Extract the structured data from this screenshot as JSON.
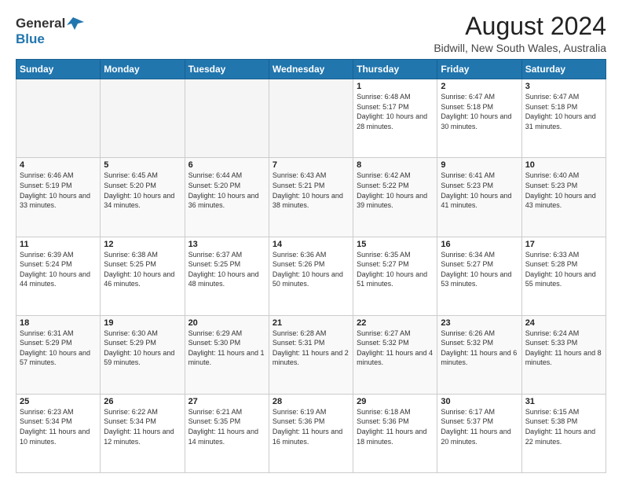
{
  "logo": {
    "line1": "General",
    "line2": "Blue"
  },
  "title": "August 2024",
  "subtitle": "Bidwill, New South Wales, Australia",
  "days_of_week": [
    "Sunday",
    "Monday",
    "Tuesday",
    "Wednesday",
    "Thursday",
    "Friday",
    "Saturday"
  ],
  "weeks": [
    [
      {
        "day": "",
        "info": ""
      },
      {
        "day": "",
        "info": ""
      },
      {
        "day": "",
        "info": ""
      },
      {
        "day": "",
        "info": ""
      },
      {
        "day": "1",
        "info": "Sunrise: 6:48 AM\nSunset: 5:17 PM\nDaylight: 10 hours and 28 minutes."
      },
      {
        "day": "2",
        "info": "Sunrise: 6:47 AM\nSunset: 5:18 PM\nDaylight: 10 hours and 30 minutes."
      },
      {
        "day": "3",
        "info": "Sunrise: 6:47 AM\nSunset: 5:18 PM\nDaylight: 10 hours and 31 minutes."
      }
    ],
    [
      {
        "day": "4",
        "info": "Sunrise: 6:46 AM\nSunset: 5:19 PM\nDaylight: 10 hours and 33 minutes."
      },
      {
        "day": "5",
        "info": "Sunrise: 6:45 AM\nSunset: 5:20 PM\nDaylight: 10 hours and 34 minutes."
      },
      {
        "day": "6",
        "info": "Sunrise: 6:44 AM\nSunset: 5:20 PM\nDaylight: 10 hours and 36 minutes."
      },
      {
        "day": "7",
        "info": "Sunrise: 6:43 AM\nSunset: 5:21 PM\nDaylight: 10 hours and 38 minutes."
      },
      {
        "day": "8",
        "info": "Sunrise: 6:42 AM\nSunset: 5:22 PM\nDaylight: 10 hours and 39 minutes."
      },
      {
        "day": "9",
        "info": "Sunrise: 6:41 AM\nSunset: 5:23 PM\nDaylight: 10 hours and 41 minutes."
      },
      {
        "day": "10",
        "info": "Sunrise: 6:40 AM\nSunset: 5:23 PM\nDaylight: 10 hours and 43 minutes."
      }
    ],
    [
      {
        "day": "11",
        "info": "Sunrise: 6:39 AM\nSunset: 5:24 PM\nDaylight: 10 hours and 44 minutes."
      },
      {
        "day": "12",
        "info": "Sunrise: 6:38 AM\nSunset: 5:25 PM\nDaylight: 10 hours and 46 minutes."
      },
      {
        "day": "13",
        "info": "Sunrise: 6:37 AM\nSunset: 5:25 PM\nDaylight: 10 hours and 48 minutes."
      },
      {
        "day": "14",
        "info": "Sunrise: 6:36 AM\nSunset: 5:26 PM\nDaylight: 10 hours and 50 minutes."
      },
      {
        "day": "15",
        "info": "Sunrise: 6:35 AM\nSunset: 5:27 PM\nDaylight: 10 hours and 51 minutes."
      },
      {
        "day": "16",
        "info": "Sunrise: 6:34 AM\nSunset: 5:27 PM\nDaylight: 10 hours and 53 minutes."
      },
      {
        "day": "17",
        "info": "Sunrise: 6:33 AM\nSunset: 5:28 PM\nDaylight: 10 hours and 55 minutes."
      }
    ],
    [
      {
        "day": "18",
        "info": "Sunrise: 6:31 AM\nSunset: 5:29 PM\nDaylight: 10 hours and 57 minutes."
      },
      {
        "day": "19",
        "info": "Sunrise: 6:30 AM\nSunset: 5:29 PM\nDaylight: 10 hours and 59 minutes."
      },
      {
        "day": "20",
        "info": "Sunrise: 6:29 AM\nSunset: 5:30 PM\nDaylight: 11 hours and 1 minute."
      },
      {
        "day": "21",
        "info": "Sunrise: 6:28 AM\nSunset: 5:31 PM\nDaylight: 11 hours and 2 minutes."
      },
      {
        "day": "22",
        "info": "Sunrise: 6:27 AM\nSunset: 5:32 PM\nDaylight: 11 hours and 4 minutes."
      },
      {
        "day": "23",
        "info": "Sunrise: 6:26 AM\nSunset: 5:32 PM\nDaylight: 11 hours and 6 minutes."
      },
      {
        "day": "24",
        "info": "Sunrise: 6:24 AM\nSunset: 5:33 PM\nDaylight: 11 hours and 8 minutes."
      }
    ],
    [
      {
        "day": "25",
        "info": "Sunrise: 6:23 AM\nSunset: 5:34 PM\nDaylight: 11 hours and 10 minutes."
      },
      {
        "day": "26",
        "info": "Sunrise: 6:22 AM\nSunset: 5:34 PM\nDaylight: 11 hours and 12 minutes."
      },
      {
        "day": "27",
        "info": "Sunrise: 6:21 AM\nSunset: 5:35 PM\nDaylight: 11 hours and 14 minutes."
      },
      {
        "day": "28",
        "info": "Sunrise: 6:19 AM\nSunset: 5:36 PM\nDaylight: 11 hours and 16 minutes."
      },
      {
        "day": "29",
        "info": "Sunrise: 6:18 AM\nSunset: 5:36 PM\nDaylight: 11 hours and 18 minutes."
      },
      {
        "day": "30",
        "info": "Sunrise: 6:17 AM\nSunset: 5:37 PM\nDaylight: 11 hours and 20 minutes."
      },
      {
        "day": "31",
        "info": "Sunrise: 6:15 AM\nSunset: 5:38 PM\nDaylight: 11 hours and 22 minutes."
      }
    ]
  ]
}
